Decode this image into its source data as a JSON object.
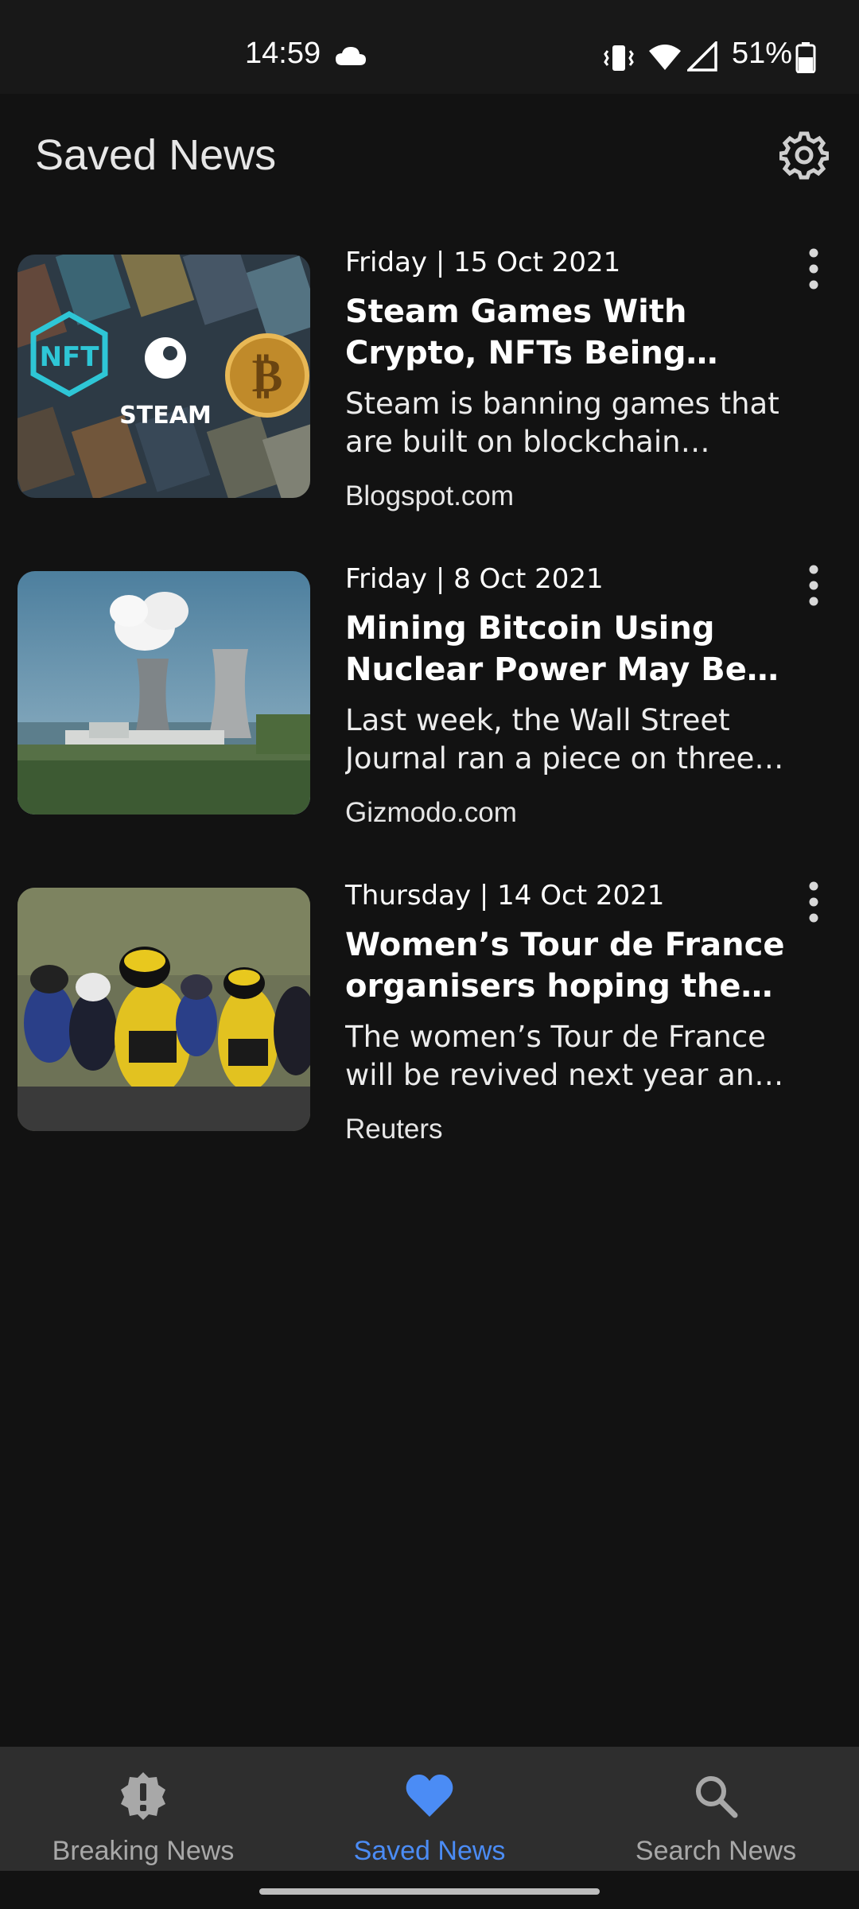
{
  "status_bar": {
    "time": "14:59",
    "battery": "51%",
    "icons": [
      "cloud-icon",
      "vibrate-icon",
      "wifi-icon",
      "signal-icon",
      "battery-icon"
    ]
  },
  "header": {
    "title": "Saved News",
    "settings_icon": "gear-icon"
  },
  "articles": [
    {
      "date": "Friday | 15 Oct 2021",
      "title": "Steam Games With Crypto, NFTs Being Removed From the Platform",
      "description": "Steam is banning games that are built on blockchain technology",
      "source": "Blogspot.com"
    },
    {
      "date": "Friday | 8 Oct 2021",
      "title": "Mining Bitcoin Using Nuclear Power May Be Fine, Actually",
      "description": "Last week, the Wall Street Journal ran a piece on three recent",
      "source": "Gizmodo.com"
    },
    {
      "date": "Thursday | 14 Oct 2021",
      "title": "Women’s Tour de France organisers hoping the race will",
      "description": "The women’s Tour de France will be revived next year and will",
      "source": "Reuters"
    }
  ],
  "thumb_text": {
    "nft": "NFT",
    "steam": "STEAM"
  },
  "bottom_nav": {
    "items": [
      {
        "label": "Breaking News",
        "icon": "alert-icon",
        "active": false
      },
      {
        "label": "Saved News",
        "icon": "heart-icon",
        "active": true
      },
      {
        "label": "Search News",
        "icon": "search-icon",
        "active": false
      }
    ]
  },
  "colors": {
    "background": "#121212",
    "accent": "#4b8cf5",
    "nav_background": "#2e2e2e"
  }
}
